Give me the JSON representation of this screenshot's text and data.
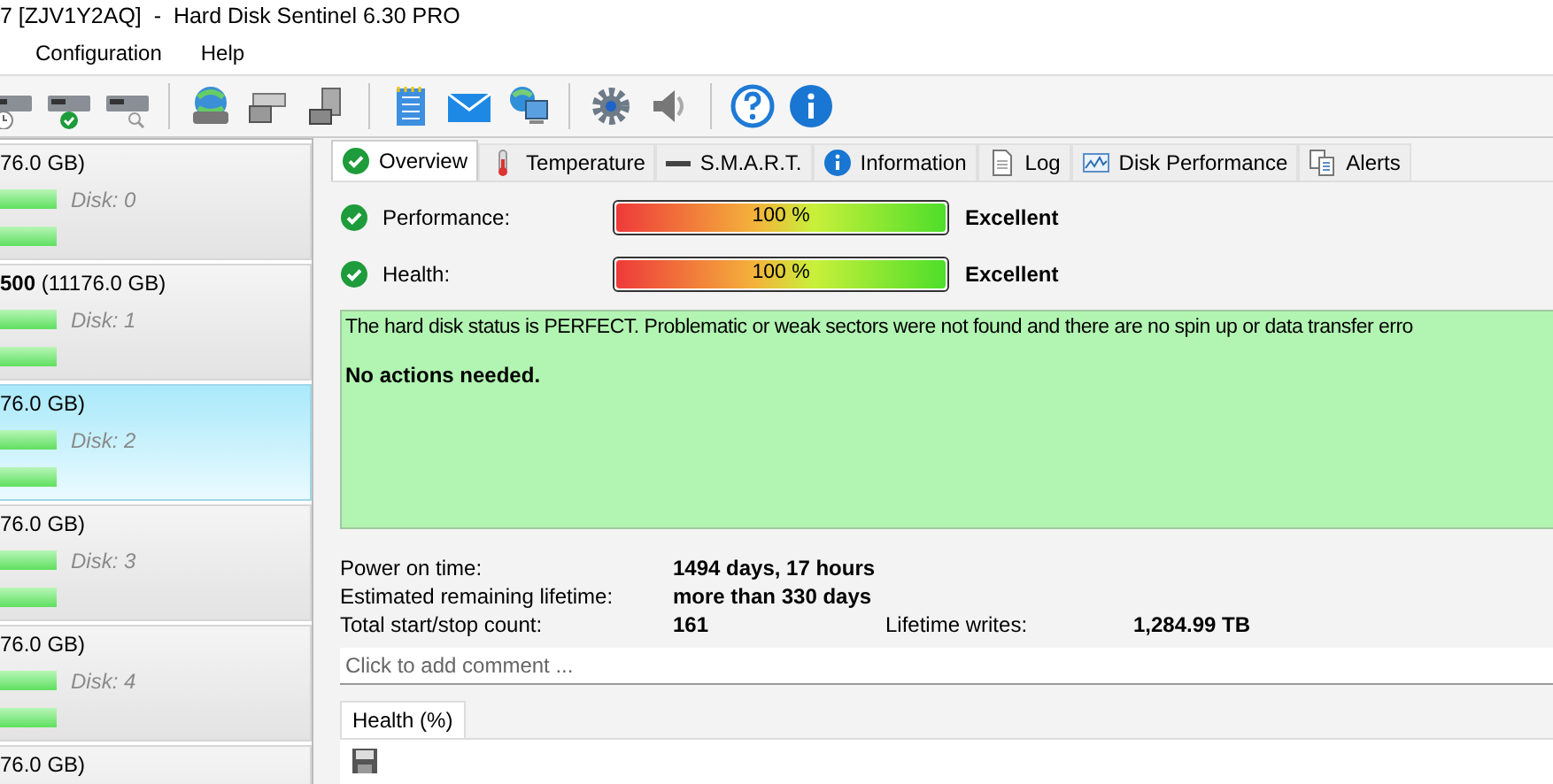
{
  "window": {
    "title": "7 [ZJV1Y2AQ]  -  Hard Disk Sentinel 6.30 PRO"
  },
  "menu": [
    {
      "label": "Configuration"
    },
    {
      "label": "Help"
    }
  ],
  "disks": [
    {
      "title": "76.0 GB)",
      "label": "Disk: 0",
      "selected": false
    },
    {
      "title": "**500** (11176.0 GB)",
      "label": "Disk: 1",
      "selected": false
    },
    {
      "title": "76.0 GB)",
      "label": "Disk: 2",
      "selected": true
    },
    {
      "title": "76.0 GB)",
      "label": "Disk: 3",
      "selected": false
    },
    {
      "title": "76.0 GB)",
      "label": "Disk: 4",
      "selected": false
    },
    {
      "title": "76.0 GB)",
      "selected": false
    }
  ],
  "tabs": [
    {
      "label": "Overview",
      "selected": true
    },
    {
      "label": "Temperature",
      "selected": false
    },
    {
      "label": "S.M.A.R.T.",
      "selected": false
    },
    {
      "label": "Information",
      "selected": false
    },
    {
      "label": "Log",
      "selected": false
    },
    {
      "label": "Disk Performance",
      "selected": false
    },
    {
      "label": "Alerts",
      "selected": false
    }
  ],
  "meters": [
    {
      "name": "Performance:",
      "level": 1.0,
      "reading": "100 %",
      "rating": "Excellent"
    },
    {
      "name": "Health:",
      "level": 1.0,
      "reading": "100 %",
      "rating": "Excellent"
    }
  ],
  "status": {
    "message": "The hard disk status is PERFECT. Problematic or weak sectors were not found and there are no spin up or data transfer erro",
    "action": "No actions needed."
  },
  "stats": [
    {
      "label": "Power on time:",
      "value": "1494 days, 17 hours"
    },
    {
      "label": "Estimated remaining lifetime:",
      "value": "more than 330 days"
    },
    {
      "label": "Total start/stop count:",
      "value": "161",
      "label_2": "Lifetime writes:",
      "value_2": "1,284.99 TB"
    }
  ],
  "comment": {
    "placeholder": "Click to add comment ..."
  },
  "bottom_tabs": [
    {
      "label": "Health (%)",
      "selected": true
    }
  ]
}
